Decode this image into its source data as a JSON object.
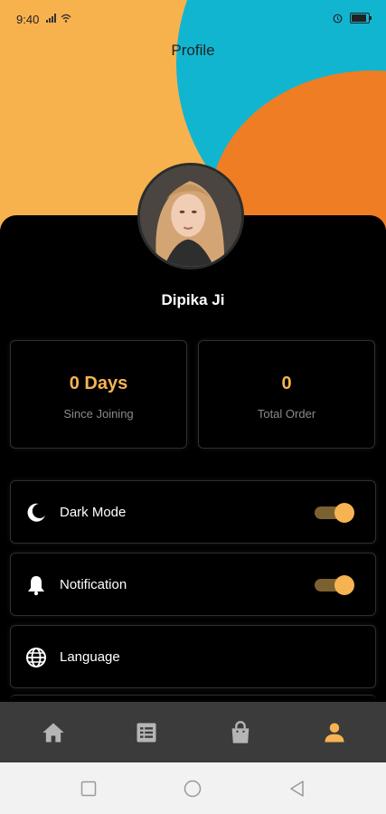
{
  "status_bar": {
    "time": "9:40"
  },
  "header": {
    "title": "Profile"
  },
  "profile": {
    "name": "Dipika Ji"
  },
  "stats": [
    {
      "value": "0 Days",
      "label": "Since Joining"
    },
    {
      "value": "0",
      "label": "Total Order"
    }
  ],
  "settings": [
    {
      "label": "Dark Mode",
      "icon": "moon-icon",
      "toggle_on": true
    },
    {
      "label": "Notification",
      "icon": "bell-icon",
      "toggle_on": true
    },
    {
      "label": "Language",
      "icon": "globe-icon"
    }
  ],
  "bottom_nav": [
    {
      "icon": "home-icon",
      "active": false
    },
    {
      "icon": "list-icon",
      "active": false
    },
    {
      "icon": "shopping-bag-icon",
      "active": false
    },
    {
      "icon": "person-icon",
      "active": true
    }
  ],
  "colors": {
    "accent": "#f5b451",
    "panel": "#000000",
    "nav_bg": "#3b3b3b",
    "bg_orange": "#f7b24e",
    "bg_cyan": "#12b5d0",
    "bg_dark_orange": "#ee7d24",
    "nav_inactive": "#b5b5b5"
  }
}
